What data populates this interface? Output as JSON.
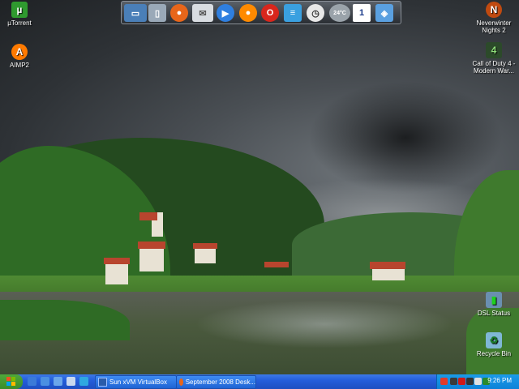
{
  "desktop": {
    "icons_left": [
      {
        "label": "µTorrent",
        "glyph": "µ",
        "color": "#2f9a2f"
      },
      {
        "label": "AIMP2",
        "glyph": "A",
        "color": "#ff7a00"
      }
    ],
    "icons_right": [
      {
        "label": "Neverwinter Nights 2",
        "glyph": "N",
        "color": "#c04a10"
      },
      {
        "label": "Call of Duty 4 - Modern War...",
        "glyph": "4",
        "color": "#2c4a2a"
      },
      {
        "label": "DSL Status",
        "glyph": "▮",
        "color": "#6a8fb0"
      },
      {
        "label": "Recycle Bin",
        "glyph": "♻",
        "color": "#7fb7d6"
      }
    ]
  },
  "dock": {
    "items": [
      {
        "name": "monitor-icon",
        "color": "#4a7fb8",
        "glyph": "▭"
      },
      {
        "name": "folder-icon",
        "color": "#9aa9b8",
        "glyph": "▯"
      },
      {
        "name": "firefox-icon",
        "color": "#e8661a",
        "glyph": "●"
      },
      {
        "name": "mail-icon",
        "color": "#d9dde2",
        "glyph": "✉"
      },
      {
        "name": "media-player-icon",
        "color": "#2f7fe0",
        "glyph": "▶"
      },
      {
        "name": "orange-ball-icon",
        "color": "#ff8a00",
        "glyph": "●"
      },
      {
        "name": "opera-icon",
        "color": "#d8261c",
        "glyph": "O"
      },
      {
        "name": "document-icon",
        "color": "#3aa0e0",
        "glyph": "≡"
      },
      {
        "name": "clock-icon",
        "color": "#e8e8e8",
        "glyph": "◷"
      },
      {
        "name": "weather-icon",
        "color": "#9aa3aa",
        "glyph": "☁"
      },
      {
        "name": "calendar-icon",
        "color": "#ffffff",
        "glyph": "1"
      },
      {
        "name": "network-icon",
        "color": "#5aa0e0",
        "glyph": "◈"
      }
    ],
    "weather_temp": "24°C",
    "calendar_day": "1"
  },
  "taskbar": {
    "tasks": [
      {
        "label": "Sun xVM VirtualBox",
        "icon": "virtualbox-icon",
        "color": "#2a5caa"
      },
      {
        "label": "September 2008 Desk...",
        "icon": "firefox-icon",
        "color": "#e8661a"
      }
    ],
    "quicklaunch": [
      "#3a7ad8",
      "#4a90e2",
      "#6aa6ea",
      "#c8d8ee",
      "#2fa8e0",
      "#e2e8f0"
    ],
    "tray_colors": [
      "#e03a2a",
      "#3a3a3a",
      "#d01818",
      "#333333",
      "#e0e0e0",
      "#2a8a2a",
      "#c8d8ee"
    ],
    "clock": "9:26 PM"
  }
}
